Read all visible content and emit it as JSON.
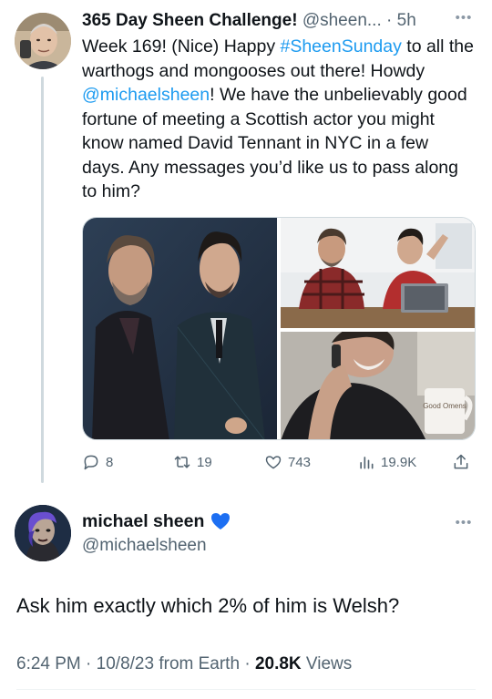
{
  "tweet1": {
    "display_name": "365 Day Sheen Challenge!",
    "handle": "@sheen...",
    "separator": "·",
    "time": "5h",
    "more": "•••",
    "body_1": "Week 169! (Nice) Happy ",
    "hashtag": "#SheenSunday",
    "body_2": " to all the warthogs and mongooses out there! Howdy ",
    "mention": "@michaelsheen",
    "body_3": "! We have the unbelievably good fortune of meeting a Scottish actor you might know named David Tennant in NYC in a few days. Any messages you’d like us to pass along to him?",
    "mug_text": "Good Omens",
    "actions": {
      "replies": "8",
      "retweets": "19",
      "likes": "743",
      "views": "19.9K"
    },
    "icons": [
      "reply-icon",
      "retweet-icon",
      "like-icon",
      "views-icon",
      "share-icon"
    ]
  },
  "tweet2": {
    "display_name": "michael sheen",
    "handle": "@michaelsheen",
    "more": "•••",
    "badge_icon": "blue-heart-icon",
    "text": "Ask him exactly which 2% of him is Welsh?",
    "time": "6:24 PM",
    "sep1": " · ",
    "date": "10/8/23",
    "source": " from Earth",
    "sep2": " · ",
    "views_count": "20.8K",
    "views_label": " Views"
  },
  "colors": {
    "link": "#1d9bf0",
    "secondary_text": "#536471",
    "primary_text": "#0f1419",
    "thread_line": "#cfd9de",
    "heart": "#1d6ff2"
  }
}
